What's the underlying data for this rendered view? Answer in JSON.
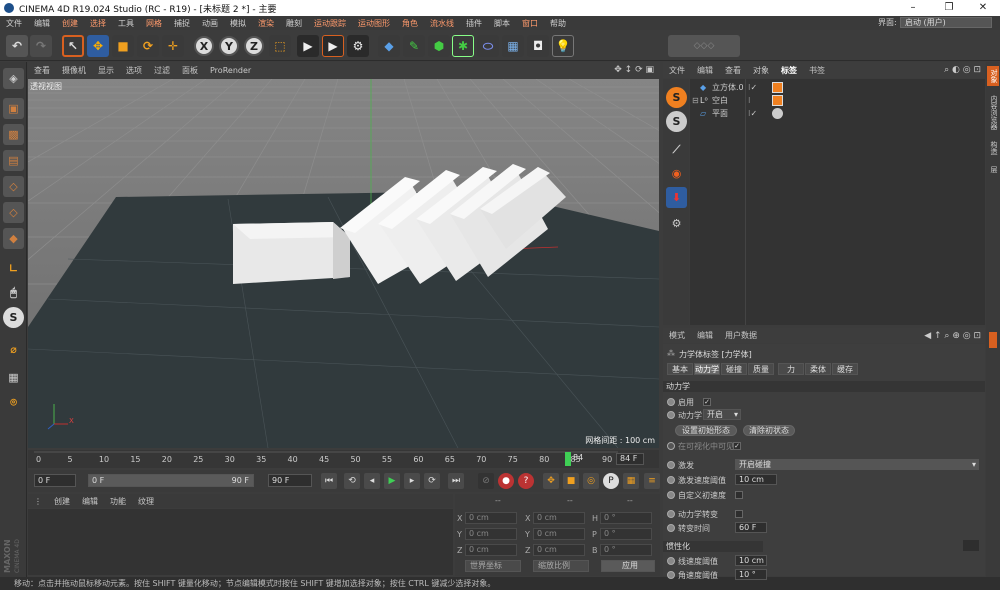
{
  "window": {
    "title": "CINEMA 4D R19.024 Studio (RC - R19) - [未标题 2 *] - 主要",
    "minimize": "–",
    "maximize": "❐",
    "close": "✕"
  },
  "menu": [
    "文件",
    "编辑",
    "创建",
    "选择",
    "工具",
    "网格",
    "捕捉",
    "动画",
    "模拟",
    "渲染",
    "雕刻",
    "运动跟踪",
    "运动图形",
    "角色",
    "流水线",
    "插件",
    "脚本",
    "窗口",
    "帮助"
  ],
  "layout": {
    "label": "界面:",
    "value": "启动 (用户)"
  },
  "viewport": {
    "menu": [
      "查看",
      "摄像机",
      "显示",
      "选项",
      "过滤",
      "面板",
      "ProRender"
    ],
    "label": "透视视图",
    "grid_spacing": "网格间距 : 100 cm"
  },
  "timeline": {
    "ticks": [
      "0",
      "5",
      "10",
      "15",
      "20",
      "25",
      "30",
      "35",
      "40",
      "45",
      "50",
      "55",
      "60",
      "65",
      "70",
      "75",
      "80",
      "85",
      "90"
    ],
    "current_frame": "84",
    "end_display": "84 F",
    "start_field": "0 F",
    "range_start": "0 F",
    "range_end": "90 F",
    "end_field": "90 F"
  },
  "materials": {
    "menu": [
      "创建",
      "编辑",
      "功能",
      "纹理"
    ],
    "logo_top": "MAXON",
    "logo_bottom": "CINEMA 4D"
  },
  "coords": {
    "headers": [
      "--",
      "--",
      "--"
    ],
    "rows": [
      {
        "l1": "X",
        "v1": "0 cm",
        "l2": "X",
        "v2": "0 cm",
        "l3": "H",
        "v3": "0 °"
      },
      {
        "l1": "Y",
        "v1": "0 cm",
        "l2": "Y",
        "v2": "0 cm",
        "l3": "P",
        "v3": "0 °"
      },
      {
        "l1": "Z",
        "v1": "0 cm",
        "l2": "Z",
        "v2": "0 cm",
        "l3": "B",
        "v3": "0 °"
      }
    ],
    "space": "世界坐标",
    "scale": "缩放比例",
    "apply": "应用"
  },
  "status": "移动：点击并拖动鼠标移动元素。按住 SHIFT 键量化移动；节点编辑模式时按住 SHIFT 键增加选择对象；按住 CTRL 键减少选择对象。",
  "object_manager": {
    "menu": [
      "文件",
      "编辑",
      "查看",
      "对象",
      "标签",
      "书签"
    ],
    "objects": [
      {
        "name": "立方体.0",
        "icon": "cube-icon"
      },
      {
        "name": "空白",
        "icon": "null-icon"
      },
      {
        "name": "平面",
        "icon": "plane-icon"
      }
    ]
  },
  "right_tabs": [
    "对象",
    "内容浏览器",
    "构造",
    "层"
  ],
  "attributes": {
    "menu": [
      "模式",
      "编辑",
      "用户数据"
    ],
    "header": "力学体标签 [力学体]",
    "tabs": [
      "基本",
      "动力学",
      "碰撞",
      "质量",
      "力",
      "柔体",
      "缓存"
    ],
    "active_tab": "动力学",
    "section_dynamics": "动力学",
    "enabled_label": "启用",
    "dynamic_label": "动力学",
    "dynamic_value": "开启",
    "set_initial": "设置初始形态",
    "clear_initial": "清除初状态",
    "visible_in_viewport": "在可视化中可见",
    "trigger_label": "激发",
    "trigger_value": "开启碰撞",
    "trigger_threshold_label": "激发速度阈值",
    "trigger_threshold_value": "10 cm",
    "custom_initial_label": "自定义初速度",
    "transition_label": "动力学转变",
    "transition_time_label": "转变时间",
    "transition_time_value": "60 F",
    "section_inertia": "惯性化",
    "linear_label": "线速度阈值",
    "linear_value": "10 cm",
    "angular_label": "角速度阈值",
    "angular_value": "10 °"
  }
}
